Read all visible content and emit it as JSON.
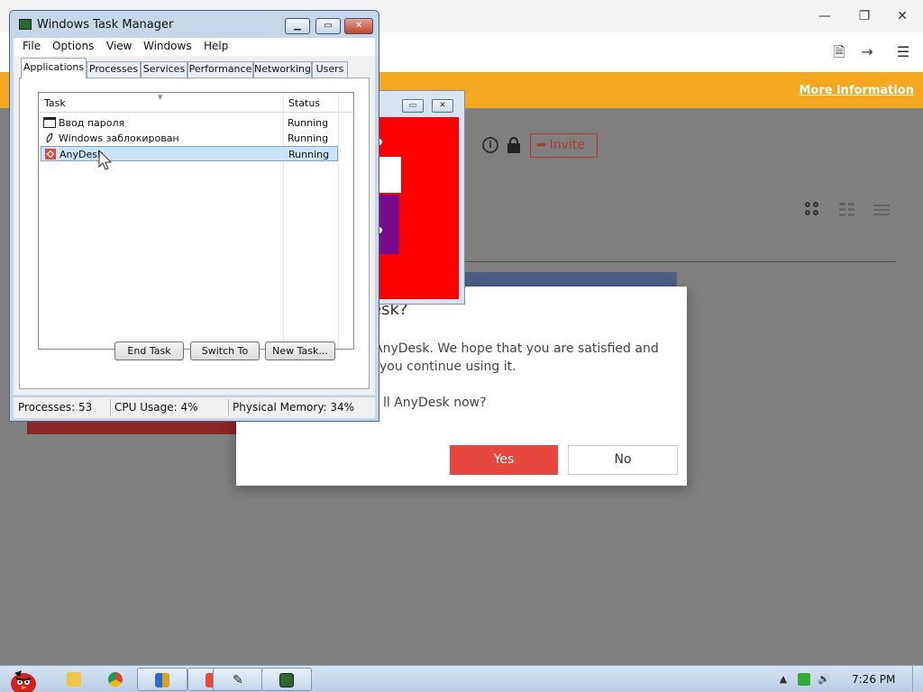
{
  "app": {
    "banner_link": "More information",
    "invite_label": "Invite",
    "colors": {
      "banner": "#f3a81f",
      "accent": "#e8473f"
    }
  },
  "dialog": {
    "title_fragment": "esk?",
    "line1": "AnyDesk. We hope that you are satisfied and",
    "line2": "you continue using it.",
    "line3": "ll AnyDesk now?",
    "yes_label": "Yes",
    "no_label": "No"
  },
  "task_manager": {
    "title": "Windows Task Manager",
    "menu": [
      "File",
      "Options",
      "View",
      "Windows",
      "Help"
    ],
    "tabs": [
      "Applications",
      "Processes",
      "Services",
      "Performance",
      "Networking",
      "Users"
    ],
    "active_tab": "Applications",
    "columns": {
      "task": "Task",
      "status": "Status"
    },
    "rows": [
      {
        "name": "Ввод пароля",
        "status": "Running",
        "icon": "window-icon"
      },
      {
        "name": "Windows заблокирован",
        "status": "Running",
        "icon": "feather-icon"
      },
      {
        "name": "AnyDesk",
        "status": "Running",
        "icon": "anydesk-icon",
        "selected": true
      }
    ],
    "buttons": {
      "end_task": "End Task",
      "switch_to": "Switch To",
      "new_task": "New Task..."
    },
    "status": {
      "processes": "Processes: 53",
      "cpu": "CPU Usage: 4%",
      "memory": "Physical Memory: 34%"
    }
  },
  "taskbar": {
    "items": [
      "angry-birds-icon",
      "folder-icon",
      "chrome-icon",
      "security-shield-icon",
      "anydesk-icon",
      "feather-icon",
      "task-manager-icon"
    ],
    "time": "7:26 PM"
  }
}
